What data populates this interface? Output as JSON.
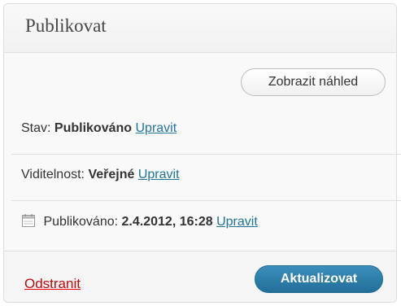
{
  "panel": {
    "title": "Publikovat"
  },
  "preview_button": {
    "label": "Zobrazit náhled"
  },
  "status": {
    "label": "Stav:",
    "value": "Publikováno",
    "edit_link": "Upravit"
  },
  "visibility": {
    "label": "Viditelnost:",
    "value": "Veřejné",
    "edit_link": "Upravit"
  },
  "published": {
    "icon": "calendar-icon",
    "label": "Publikováno:",
    "value": "2.4.2012, 16:28",
    "edit_link": "Upravit"
  },
  "actions": {
    "delete_label": "Odstranit",
    "update_label": "Aktualizovat"
  },
  "colors": {
    "link": "#21759b",
    "delete": "#bc0b0b",
    "primary_button": "#2a7aa8"
  }
}
